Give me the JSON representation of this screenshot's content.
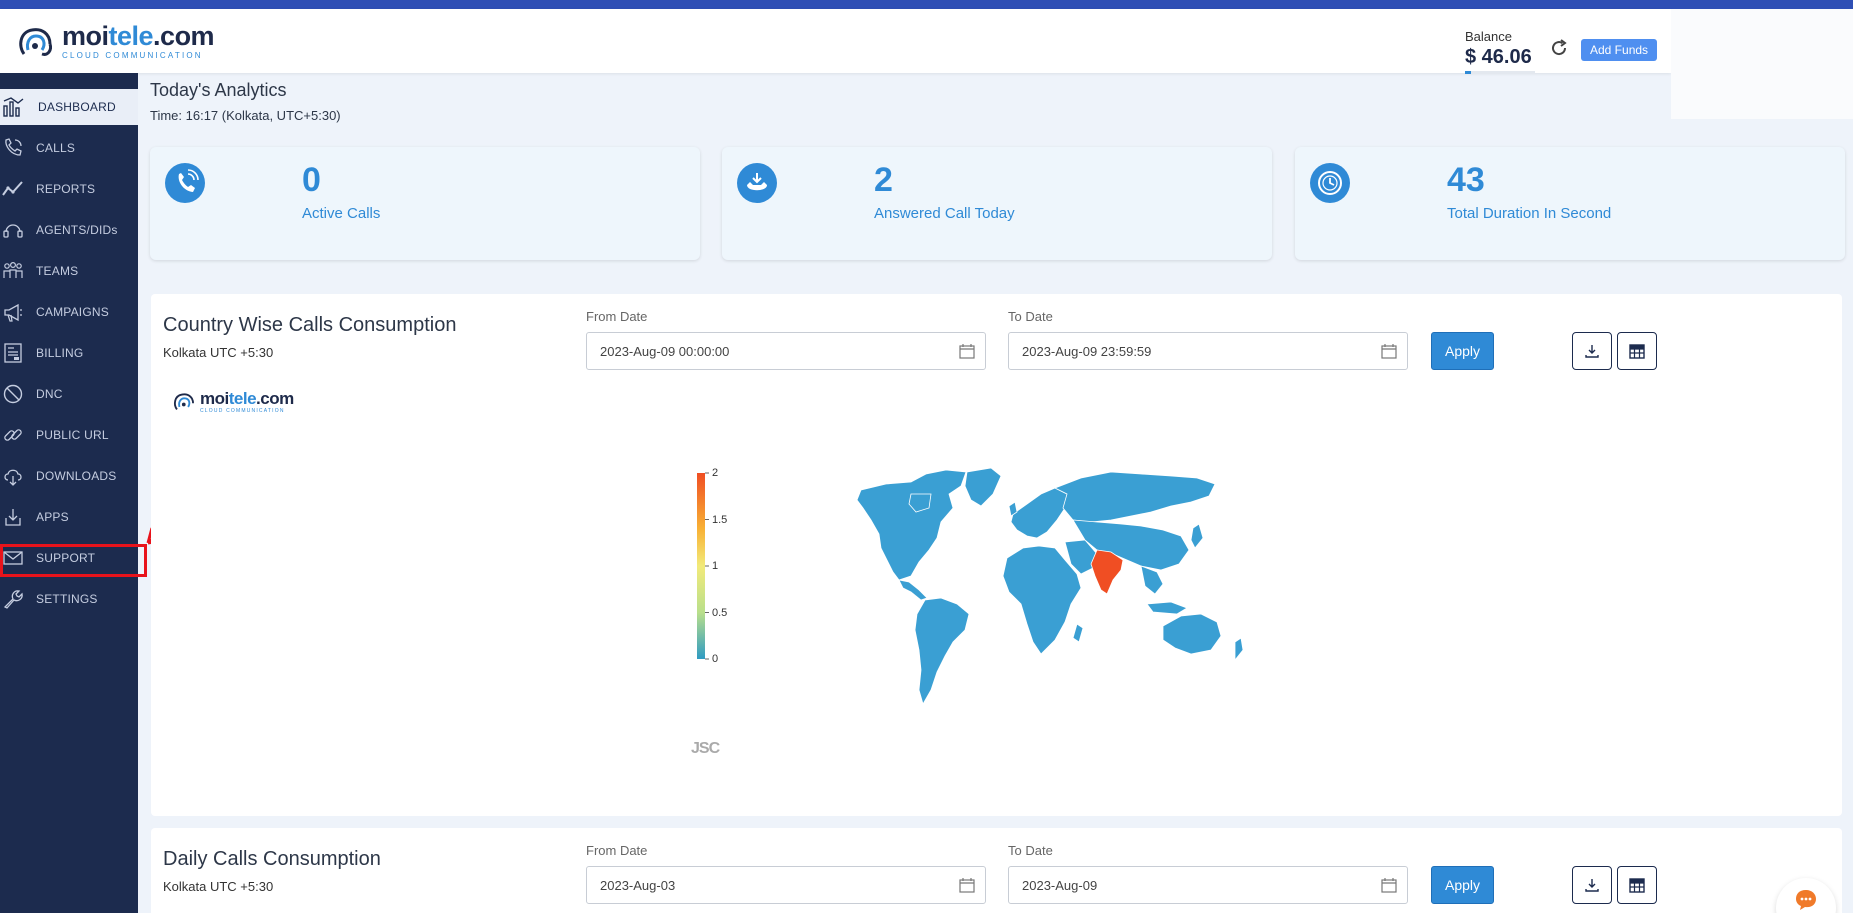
{
  "header": {
    "logo_main_1": "moi",
    "logo_main_2": "tele",
    "logo_main_3": ".com",
    "logo_sub": "CLOUD COMMUNICATION",
    "balance_label": "Balance",
    "balance_value": "$ 46.06",
    "add_funds_label": "Add Funds"
  },
  "sidebar": {
    "items": [
      {
        "label": "DASHBOARD",
        "icon": "chart-bar-icon"
      },
      {
        "label": "CALLS",
        "icon": "phone-icon"
      },
      {
        "label": "REPORTS",
        "icon": "trend-line-icon"
      },
      {
        "label": "AGENTS/DIDs",
        "icon": "headset-icon"
      },
      {
        "label": "TEAMS",
        "icon": "team-icon"
      },
      {
        "label": "CAMPAIGNS",
        "icon": "megaphone-icon"
      },
      {
        "label": "BILLING",
        "icon": "invoice-icon"
      },
      {
        "label": "DNC",
        "icon": "ban-icon"
      },
      {
        "label": "PUBLIC URL",
        "icon": "link-icon"
      },
      {
        "label": "DOWNLOADS",
        "icon": "cloud-download-icon"
      },
      {
        "label": "APPS",
        "icon": "app-download-icon"
      },
      {
        "label": "SUPPORT",
        "icon": "mail-icon"
      },
      {
        "label": "SETTINGS",
        "icon": "wrench-icon"
      }
    ]
  },
  "analytics": {
    "title": "Today's Analytics",
    "time": "Time: 16:17 (Kolkata, UTC+5:30)",
    "cards": [
      {
        "value": "0",
        "label": "Active Calls",
        "icon": "phone-call-icon"
      },
      {
        "value": "2",
        "label": "Answered Call Today",
        "icon": "answered-call-icon"
      },
      {
        "value": "43",
        "label": "Total Duration In Second",
        "icon": "clock-icon"
      }
    ]
  },
  "country_panel": {
    "title": "Country Wise Calls Consumption",
    "timezone": "Kolkata UTC +5:30",
    "from_label": "From Date",
    "from_value": "2023-Aug-09   00:00:00",
    "to_label": "To Date",
    "to_value": "2023-Aug-09   23:59:59",
    "apply_label": "Apply",
    "watermark": "JSC",
    "map_legend": {
      "ticks": [
        "2",
        "1.5",
        "1",
        "0.5",
        "0"
      ],
      "colors": [
        "#f04e23",
        "#f8c435",
        "#f2ea7a",
        "#b9df8b",
        "#2f9bc2"
      ]
    },
    "highlighted_country": "India",
    "highlighted_value": 2,
    "map_colors": {
      "land": "#3a9fd3",
      "highlight": "#f04e23"
    }
  },
  "daily_panel": {
    "title": "Daily Calls Consumption",
    "timezone": "Kolkata UTC +5:30",
    "from_label": "From Date",
    "from_value": "2023-Aug-03",
    "to_label": "To Date",
    "to_value": "2023-Aug-09",
    "apply_label": "Apply"
  },
  "colors": {
    "accent": "#2f8ad6",
    "sidebar": "#1c2b4e",
    "annotation": "#e8131b"
  }
}
